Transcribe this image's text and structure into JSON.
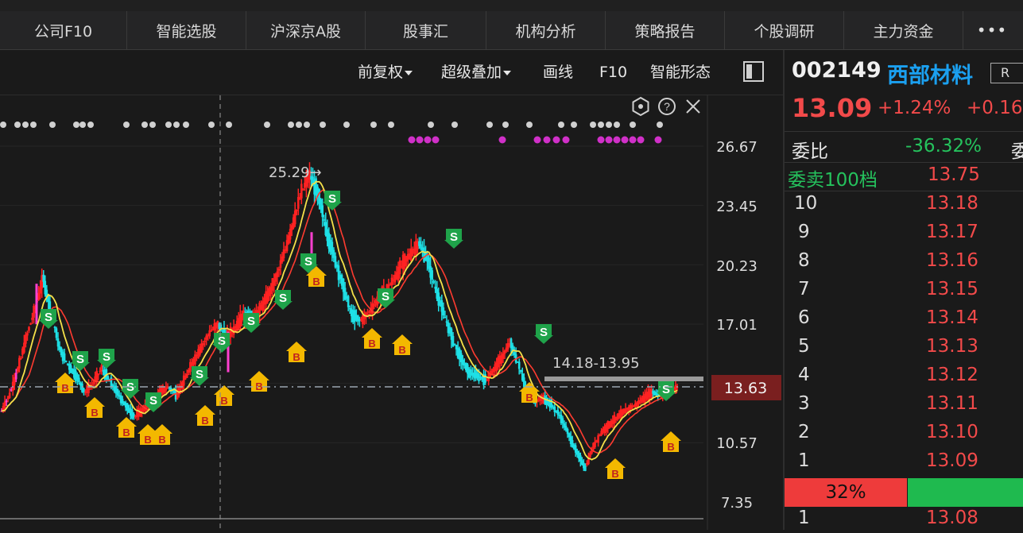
{
  "tabs": [
    "公司F10",
    "智能选股",
    "沪深京A股",
    "股事汇",
    "机构分析",
    "策略报告",
    "个股调研",
    "主力资金"
  ],
  "more_label": "•••",
  "toolbar": {
    "fuquan": "前复权",
    "overlay": "超级叠加",
    "draw": "画线",
    "f10": "F10",
    "pattern": "智能形态"
  },
  "chart": {
    "y_ticks": [
      "26.67",
      "23.45",
      "20.23",
      "17.01",
      "10.57",
      "7.35"
    ],
    "current_price_tag": "13.63",
    "high_label": "25.29→",
    "range_label": "14.18-13.95",
    "buy_marker": "B",
    "sell_marker": "S"
  },
  "chart_data": {
    "type": "candlestick",
    "ylim": [
      7.35,
      28
    ],
    "high": 25.29,
    "reference_price": 13.63,
    "price_path": [
      12.3,
      13.2,
      14.6,
      16.3,
      17.8,
      19.5,
      17.6,
      15.6,
      14.8,
      14.2,
      13.3,
      13.8,
      14.6,
      13.9,
      13.2,
      12.5,
      12.0,
      12.4,
      12.8,
      13.3,
      13.6,
      13.2,
      14.0,
      15.0,
      15.8,
      16.6,
      17.0,
      16.3,
      16.8,
      17.6,
      17.3,
      17.8,
      18.6,
      19.6,
      21.0,
      22.6,
      24.2,
      25.1,
      24.0,
      22.0,
      20.5,
      19.0,
      17.5,
      17.2,
      17.6,
      18.3,
      18.8,
      19.4,
      20.2,
      20.8,
      21.4,
      20.6,
      19.0,
      17.6,
      16.3,
      15.2,
      14.4,
      14.2,
      14.0,
      14.5,
      15.2,
      16.0,
      14.8,
      13.4,
      12.8,
      13.0,
      12.6,
      12.0,
      11.0,
      10.0,
      9.2,
      10.4,
      11.2,
      11.6,
      12.0,
      12.4,
      12.6,
      13.0,
      13.3,
      13.2,
      13.4,
      13.6
    ]
  },
  "quote": {
    "code": "002149",
    "name": "西部材料",
    "r_btn": "R",
    "price": "13.09",
    "pct": "+1.24%",
    "change": "+0.16",
    "weibi_label": "委比",
    "weibi_value": "-36.32%",
    "weibi_extra": "委",
    "sell_level_label": "委卖100档",
    "sell_level_price": "13.75",
    "asks": [
      {
        "n": "10",
        "p": "13.18"
      },
      {
        "n": "9",
        "p": "13.17"
      },
      {
        "n": "8",
        "p": "13.16"
      },
      {
        "n": "7",
        "p": "13.15"
      },
      {
        "n": "6",
        "p": "13.14"
      },
      {
        "n": "5",
        "p": "13.13"
      },
      {
        "n": "4",
        "p": "13.12"
      },
      {
        "n": "3",
        "p": "13.11"
      },
      {
        "n": "2",
        "p": "13.10"
      },
      {
        "n": "1",
        "p": "13.09"
      }
    ],
    "ratio_label": "32%",
    "bid1_n": "1",
    "bid1_p": "13.08"
  },
  "colors": {
    "up": "#f22",
    "down": "#1ee0e6",
    "ma": "#f5e14a",
    "bg": "#1a1a1a",
    "buy": "#f3b800",
    "sell": "#1fa34a"
  }
}
